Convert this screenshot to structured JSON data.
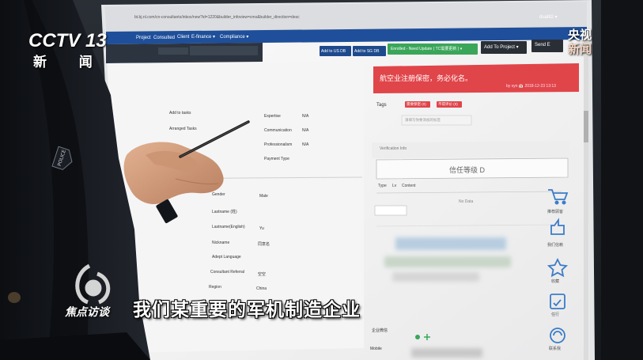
{
  "overlays": {
    "channel_logo": "CCTV 13",
    "channel_sub": "新 闻",
    "badge_top": "央视",
    "badge_bottom": "新闻",
    "program_name": "焦点访谈",
    "subtitle": "我们某重要的军机制造企业"
  },
  "screen": {
    "nav_items": [
      "Project",
      "Consulted",
      "Client",
      "E-finance ▾",
      "Compliance ▾"
    ],
    "toolbar_buttons": [
      "Add to US DB",
      "Add to SG DB",
      "Enrolled - Need Update ( TC需要更新 ) ▾",
      "Add To Project ▾",
      "Send E"
    ],
    "alert_text": "航空业注册保密，务必化名。",
    "alert_meta": "by syn 📅 2018-12-23 13:13",
    "tags_label": "Tags",
    "tags": [
      "需要保密 (0)",
      "不得评价 (0)"
    ],
    "tag_input_placeholder": "请填写你要添加的标签",
    "verification_label": "Verification Info",
    "trust_level": "信任等级 D",
    "contact_tabs": [
      "Type",
      "Lv",
      "Content"
    ],
    "no_data": "No Data",
    "left_fields_top": [
      "Add to tasks",
      "Arranged Tasks"
    ],
    "right_fields": [
      {
        "label": "Expertise",
        "value": "N/A"
      },
      {
        "label": "Communication",
        "value": "N/A"
      },
      {
        "label": "Professionalism",
        "value": "N/A"
      },
      {
        "label": "Payment Type",
        "value": ""
      }
    ],
    "profile_fields": [
      {
        "label": "Gender",
        "value": "Male"
      },
      {
        "label": "Lastname (姓)",
        "value": ""
      },
      {
        "label": "Lastname(English)",
        "value": "Yu"
      },
      {
        "label": "Nickname",
        "value": "同意名"
      },
      {
        "label": "Adept Language",
        "value": ""
      },
      {
        "label": "Consultant Referral",
        "value": "空空"
      },
      {
        "label": "Region",
        "value": "China"
      }
    ],
    "company_label": "企业微信",
    "mobile_label": "Mobile",
    "user_menu": "dual82 ▾"
  },
  "sidebar_tools": [
    {
      "icon": "cart-icon",
      "label": "推荐顾客"
    },
    {
      "icon": "thumbs-up-icon",
      "label": "我们信赖"
    },
    {
      "icon": "star-icon",
      "label": "收藏"
    },
    {
      "icon": "checklist-icon",
      "label": "任行"
    },
    {
      "icon": "support-icon",
      "label": "联系我"
    }
  ],
  "colors": {
    "nav_bar": "#1f4f9a",
    "alert_red": "#e0454a",
    "enrolled_green": "#3aa65a",
    "subtitle_text": "#ffffff"
  }
}
